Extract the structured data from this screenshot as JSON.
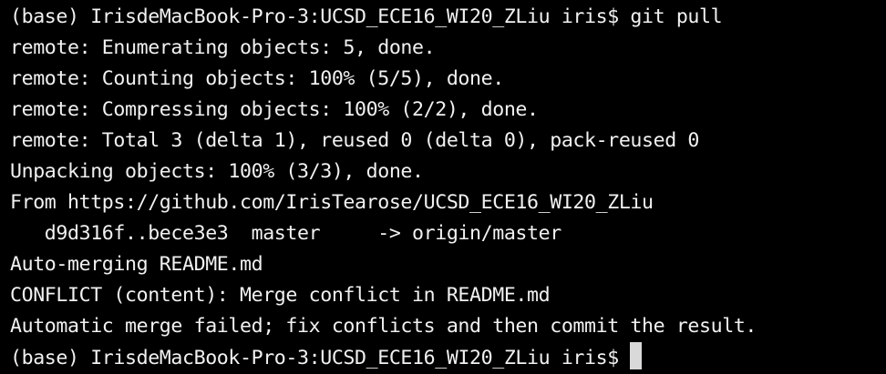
{
  "terminal": {
    "lines": [
      "(base) IrisdeMacBook-Pro-3:UCSD_ECE16_WI20_ZLiu iris$ git pull",
      "remote: Enumerating objects: 5, done.",
      "remote: Counting objects: 100% (5/5), done.",
      "remote: Compressing objects: 100% (2/2), done.",
      "remote: Total 3 (delta 1), reused 0 (delta 0), pack-reused 0",
      "Unpacking objects: 100% (3/3), done.",
      "From https://github.com/IrisTearose/UCSD_ECE16_WI20_ZLiu",
      "   d9d316f..bece3e3  master     -> origin/master",
      "Auto-merging README.md",
      "CONFLICT (content): Merge conflict in README.md",
      "Automatic merge failed; fix conflicts and then commit the result.",
      "(base) IrisdeMacBook-Pro-3:UCSD_ECE16_WI20_ZLiu iris$"
    ]
  },
  "colors": {
    "background": "#000000",
    "text": "#f1f1f1",
    "cursor": "#d9d9d9"
  }
}
